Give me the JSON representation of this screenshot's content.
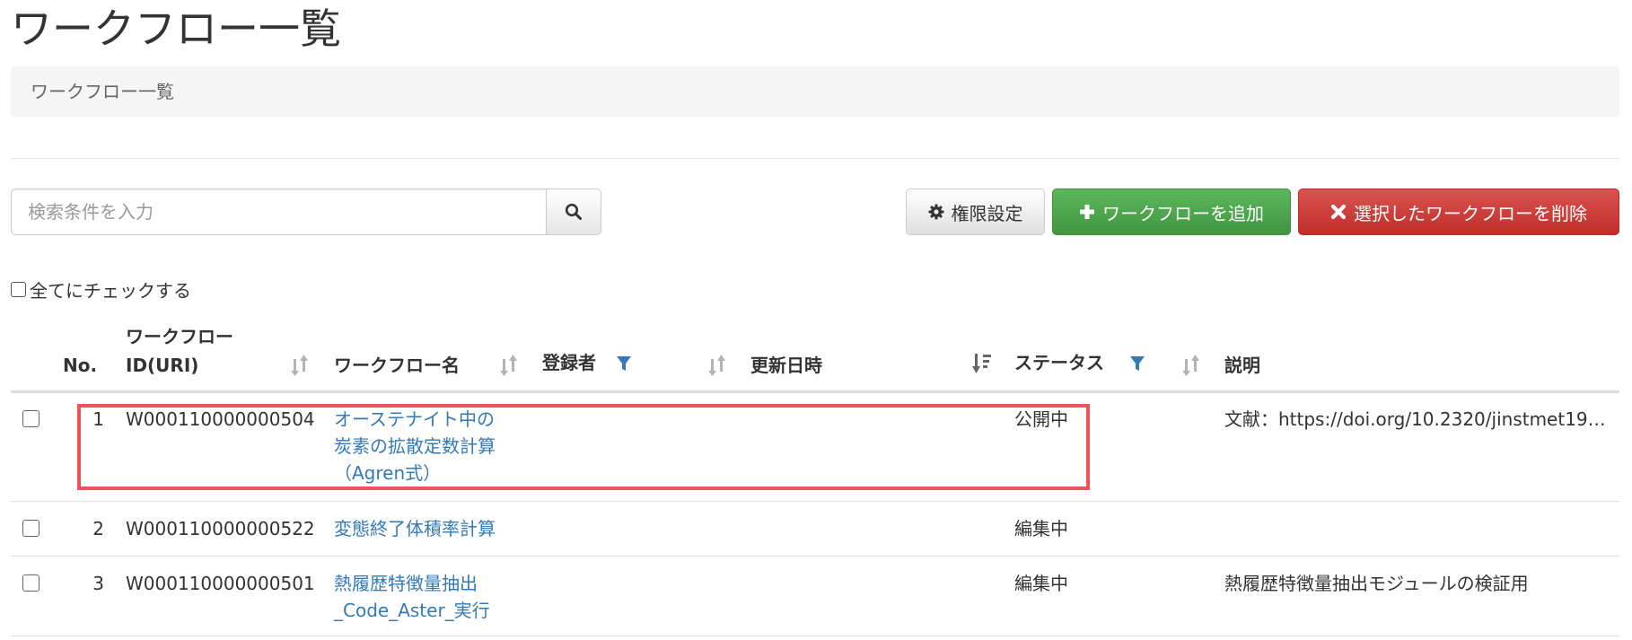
{
  "page": {
    "title": "ワークフロー一覧",
    "breadcrumb": "ワークフロー一覧"
  },
  "toolbar": {
    "search_placeholder": "検索条件を入力",
    "search_icon": "search-icon",
    "permission_label": "権限設定",
    "permission_icon": "gear-icon",
    "add_label": "ワークフローを追加",
    "add_icon": "plus-icon",
    "delete_label": "選択したワークフローを削除",
    "delete_icon": "close-icon"
  },
  "check_all_label": "全てにチェックする",
  "colors": {
    "link": "#337ab7",
    "add_button": "#5cb85c",
    "delete_button": "#d9534f",
    "highlight": "#f0525c",
    "sort_icon": "#b3b3b3",
    "filter_icon": "#337ab7"
  },
  "table": {
    "columns": {
      "no": "No.",
      "id_line1": "ワークフロー",
      "id_line2": "ID(URI)",
      "name": "ワークフロー名",
      "registrant": "登録者",
      "updated": "更新日時",
      "status": "ステータス",
      "description": "説明"
    },
    "rows": [
      {
        "no": "1",
        "id": "W000110000000504",
        "name_lines": [
          "オーステナイト中の",
          "炭素の拡散定数計算",
          "（Agren式）"
        ],
        "registrant": "",
        "updated": "",
        "status": "公開中",
        "description": "文献：https://doi.org/10.2320/jinstmet19…",
        "highlighted": true
      },
      {
        "no": "2",
        "id": "W000110000000522",
        "name_lines": [
          "変態終了体積率計算"
        ],
        "registrant": "",
        "updated": "",
        "status": "編集中",
        "description": ""
      },
      {
        "no": "3",
        "id": "W000110000000501",
        "name_lines": [
          "熱履歴特徴量抽出",
          "_Code_Aster_実行"
        ],
        "registrant": "",
        "updated": "",
        "status": "編集中",
        "description": "熱履歴特徴量抽出モジュールの検証用"
      }
    ]
  }
}
